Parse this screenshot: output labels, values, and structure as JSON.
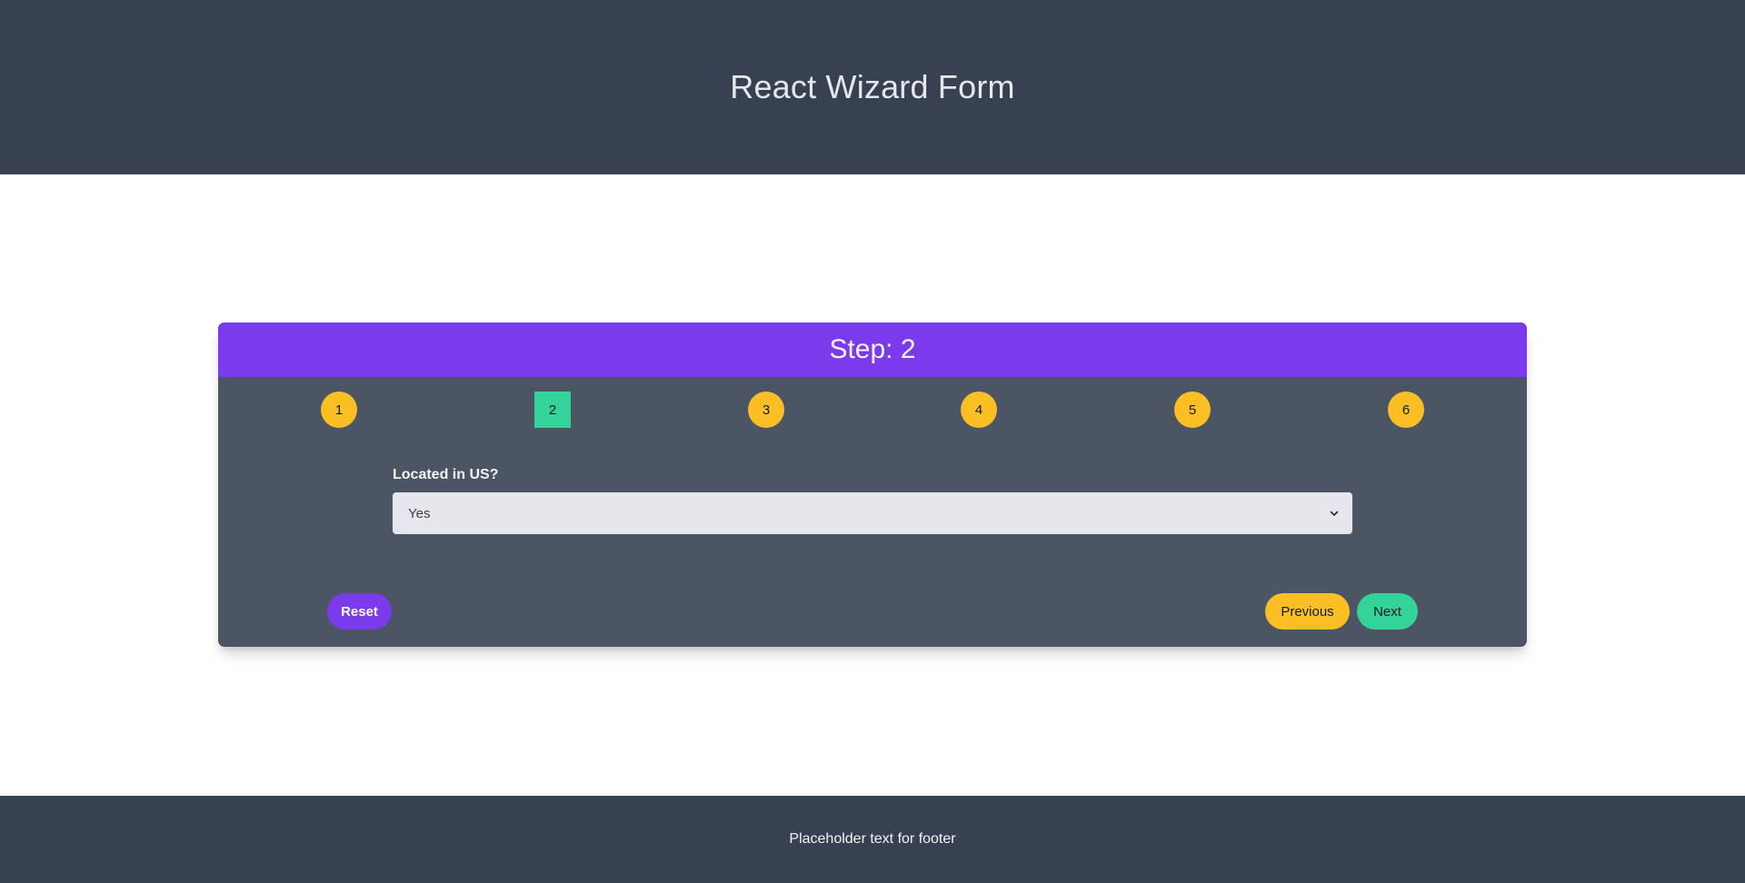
{
  "header": {
    "title": "React Wizard Form"
  },
  "wizard": {
    "step_title": "Step: 2",
    "steps": [
      {
        "label": "1"
      },
      {
        "label": "2"
      },
      {
        "label": "3"
      },
      {
        "label": "4"
      },
      {
        "label": "5"
      },
      {
        "label": "6"
      }
    ],
    "active_step": "2",
    "field": {
      "label": "Located in US?",
      "value": "Yes"
    },
    "buttons": {
      "reset": "Reset",
      "previous": "Previous",
      "next": "Next"
    }
  },
  "footer": {
    "text": "Placeholder text for footer"
  },
  "colors": {
    "header_bg": "#374151",
    "card_bg": "#4b5563",
    "accent_purple": "#7c3aed",
    "step_yellow": "#fbbf24",
    "step_active_green": "#34d399"
  }
}
